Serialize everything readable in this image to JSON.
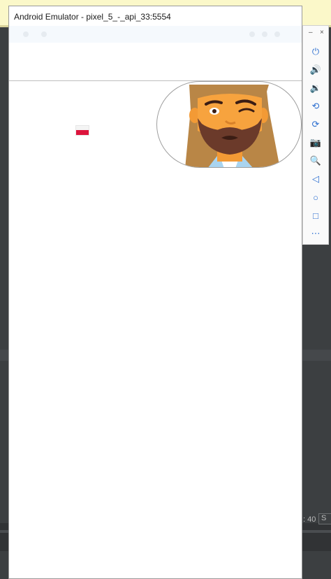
{
  "emulator": {
    "title": "Android Emulator - pixel_5_-_api_33:5554"
  },
  "app": {
    "flag_icon": "poland-flag-icon",
    "avatar_icon": "bearded-man-winking-avatar"
  },
  "toolbar": {
    "minimize": "–",
    "close": "×",
    "items": [
      {
        "name": "power-icon",
        "glyph": "⏻"
      },
      {
        "name": "volume-up-icon",
        "glyph": "🔊"
      },
      {
        "name": "volume-down-icon",
        "glyph": "🔉"
      },
      {
        "name": "rotate-left-icon",
        "glyph": "⟲"
      },
      {
        "name": "rotate-right-icon",
        "glyph": "⟳"
      },
      {
        "name": "camera-icon",
        "glyph": "📷"
      },
      {
        "name": "zoom-icon",
        "glyph": "🔍"
      },
      {
        "name": "back-icon",
        "glyph": "◁"
      },
      {
        "name": "home-icon",
        "glyph": "○"
      },
      {
        "name": "overview-icon",
        "glyph": "□"
      },
      {
        "name": "more-icon",
        "glyph": "⋯"
      }
    ]
  },
  "ide": {
    "status_text": ": 40",
    "status_button": "S"
  },
  "colors": {
    "ide_background": "#3c3f41",
    "notification_bar": "#fbf8c9",
    "accent_blue": "#2d6fd0",
    "flag_red": "#dc143c"
  }
}
